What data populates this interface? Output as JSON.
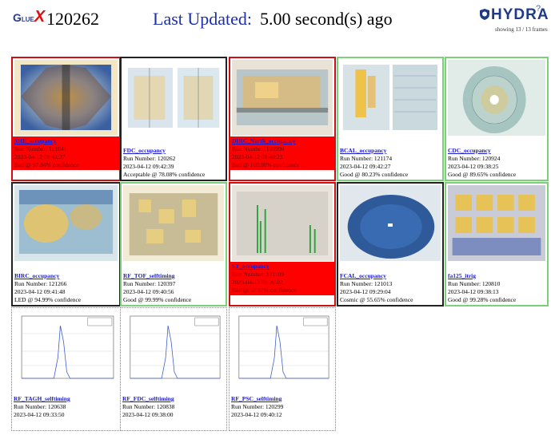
{
  "header": {
    "logo_g": "G",
    "logo_lue": "LUE",
    "logo_x": "X",
    "run_number": "120262",
    "updated_label": "Last Updated:",
    "updated_value": "5.00 second(s) ago",
    "brand": "HYDRA",
    "brand_mark": "?",
    "showing": "showing 13 / 13 frames"
  },
  "colors": {
    "bad": "#ff0000",
    "good_border": "#7dd07a",
    "link": "#1b1bd0",
    "title": "#1b2fb0"
  },
  "cards": [
    {
      "title": "SHE_occupancy",
      "run": "Run Number: 121041",
      "time": "2023-04-12 09:41:37",
      "verdict": "Bad @ 97.84% confidence",
      "status": "bad"
    },
    {
      "title": "FDC_occupancy",
      "run": "Run Number: 120262",
      "time": "2023-04-12 09:42:39",
      "verdict": "Acceptable @ 78.08% confidence",
      "status": "acc"
    },
    {
      "title": "DIRC_North_occupancy",
      "run": "Run Number: 120990",
      "time": "2023-04-12 09:40:23",
      "verdict": "Bad @ 100.00% confidence",
      "status": "bad"
    },
    {
      "title": "BCAL_occupancy",
      "run": "Run Number: 121174",
      "time": "2023-04-12 09:42:27",
      "verdict": "Good @ 80.23% confidence",
      "status": "good"
    },
    {
      "title": "CDC_occupancy",
      "run": "Run Number: 120924",
      "time": "2023-04-12 09:38:25",
      "verdict": "Good @ 89.65% confidence",
      "status": "good"
    },
    {
      "title": "BIRC_occupancy",
      "run": "Run Number: 121266",
      "time": "2023-04-12 09:41:48",
      "verdict": "LED @ 94.99% confidence",
      "status": "led"
    },
    {
      "title": "RF_TOF_selftiming",
      "run": "Run Number: 120397",
      "time": "2023-04-12 09:40:56",
      "verdict": "Good @ 99.99% confidence",
      "status": "good"
    },
    {
      "title": "ST_occupancy",
      "run": "Run Number: 121109",
      "time": "2023-04-12 09:26:02",
      "verdict": "Bad @ 97.57% confidence",
      "status": "bad"
    },
    {
      "title": "FCAL_occupancy",
      "run": "Run Number: 121013",
      "time": "2023-04-12 09:29:04",
      "verdict": "Cosmic @ 55.65% confidence",
      "status": "cos"
    },
    {
      "title": "fa125_itrig",
      "run": "Run Number: 120810",
      "time": "2023-04-12 09:38:13",
      "verdict": "Good @ 99.28% confidence",
      "status": "good"
    },
    {
      "title": "RF_TAGH_selftiming",
      "run": "Run Number: 120638",
      "time": "2023-04-12 09:33:50",
      "verdict": "",
      "status": "none"
    },
    {
      "title": "RF_FDC_selftiming",
      "run": "Run Number: 120838",
      "time": "2023-04-12 09:38:00",
      "verdict": "",
      "status": "none"
    },
    {
      "title": "RF_PSC_selftiming",
      "run": "Run Number: 120299",
      "time": "2023-04-12 09:40:12",
      "verdict": "",
      "status": "none"
    }
  ]
}
